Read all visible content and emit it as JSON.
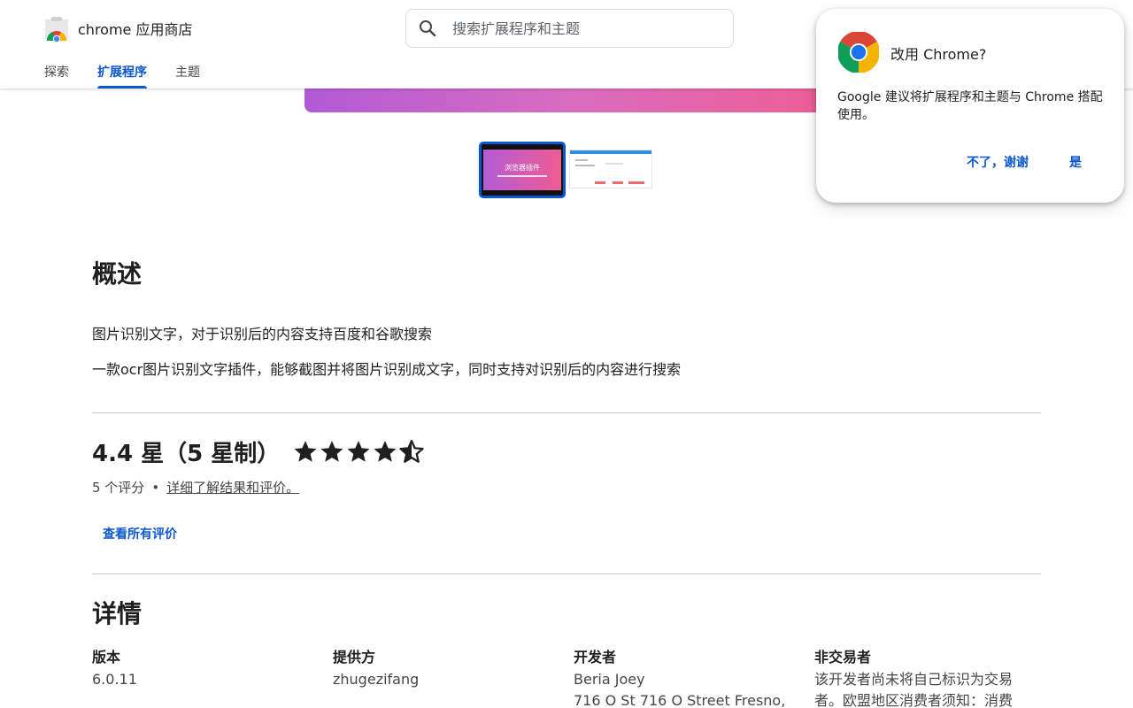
{
  "header": {
    "brand_name": "chrome 应用商店",
    "search": {
      "placeholder": "搜索扩展程序和主题",
      "value": ""
    },
    "tabs": [
      {
        "label": "探索",
        "active": false
      },
      {
        "label": "扩展程序",
        "active": true
      },
      {
        "label": "主题",
        "active": false
      }
    ]
  },
  "gallery": {
    "thumbnail_1_text": "浏览器插件"
  },
  "overview": {
    "title": "概述",
    "lines": [
      "图片识别文字，对于识别后的内容支持百度和谷歌搜索",
      "一款ocr图片识别文字插件，能够截图并将图片识别成文字，同时支持对识别后的内容进行搜索"
    ]
  },
  "rating": {
    "summary": "4.4 星（5 星制）",
    "value": 4.4,
    "max": 5,
    "count_text": "5 个评分",
    "separator": "•",
    "learn_more": "详细了解结果和评价。",
    "see_all": "查看所有评价"
  },
  "details": {
    "title": "详情",
    "columns": [
      {
        "label": "版本",
        "value": "6.0.11"
      },
      {
        "label": "提供方",
        "value": "zhugezifang"
      },
      {
        "label": "开发者",
        "value": "Beria Joey\n716 O St 716 O Street Fresno,"
      },
      {
        "label": "非交易者",
        "value": "该开发者尚未将自己标识为交易者。欧盟地区消费者须知：消费"
      }
    ]
  },
  "popup": {
    "title": "改用 Chrome?",
    "body": "Google 建议将扩展程序和主题与 Chrome 搭配使用。",
    "no_label": "不了，谢谢",
    "yes_label": "是"
  },
  "colors": {
    "accent": "#0b57d0",
    "star": "#1f1f1f",
    "banner_start": "#b15ad6",
    "banner_end": "#ee5f96"
  }
}
